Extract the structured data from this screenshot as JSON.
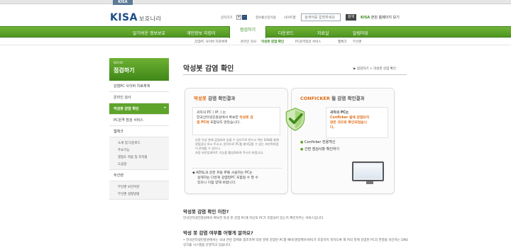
{
  "header": {
    "top_tab": "KISA",
    "logo": "KISA",
    "logo_sub": "보호나라",
    "util_font_label": "글자크기",
    "util_font_plus": "+",
    "util_font_minus": "-",
    "util_links": [
      "정보통신망이용",
      "사이트맵"
    ],
    "search_placeholder": "검색어를 입력하세요",
    "search_button": "검색",
    "kisa_link_prefix": "KISA",
    "kisa_link_text": "본원 홈페이지 보기"
  },
  "gnb": [
    {
      "label": "알기쉬운 정보보호"
    },
    {
      "label": "개인정보 지킴이"
    },
    {
      "label": "점검하기"
    },
    {
      "label": "다운로드"
    },
    {
      "label": "자료실"
    },
    {
      "label": "알림마당"
    }
  ],
  "subnav": [
    "감염PC 사이버 치료체계",
    "온라인 검사",
    "악성봇 감염 확인",
    "PC원격점검 서비스",
    "웹체크",
    "무선랜"
  ],
  "lnb": {
    "head_en": "BOHO",
    "head_ko": "점검하기",
    "items": [
      "감염PC 사이버 치료체계",
      "온라인 검사",
      "악성봇 감염 확인",
      "PC원격 점검 서비스",
      "웹체크"
    ],
    "webcheck_sub": [
      "소개 및 다운로드",
      "주요기능",
      "결점도 적용 및 조치법",
      "도움말"
    ],
    "wireless": "무선랜",
    "wireless_sub": [
      "무선랜 보안이란",
      "무선랜 설정방법"
    ]
  },
  "content": {
    "title": "악성봇 감염 확인",
    "breadcrumb": [
      "▶ 점검하기",
      ">",
      "악성봇 감염 확인"
    ],
    "box1": {
      "title_hl": "악성봇",
      "title_rest": " 감염 확인결과",
      "line1": "귀하의 PC ( IP:                         ) 는",
      "line2a": "한국인터넷진흥원에서 확보한 ",
      "line2b": "악성봇 감",
      "line3a": "염 PC에",
      "line3b": " 포함되지 않았습니다.",
      "small": [
        "다른 악성 봇에 감염되어 있을 수 있으므로 반드시 백신 S/W를 통해 정밀검사 하시 주시고, 원격으로 PC를 제어당할 수 있는 보안취약점이 존재할 수 있으니",
        "자동 보안업데이트 기능을 활성화하여 주시기 바랍니다."
      ],
      "note": [
        "ADSL과 같은 유동 IP를 사용하는 PC는",
        "실제하는 다른게 감염된PC 포함될 수 할 수",
        "있으니 이점 양해 바랍니다."
      ]
    },
    "box2": {
      "title_hl": "CONFICKER",
      "title_rest": " 웜 감염 확인결과",
      "line1": "귀하의 PC는",
      "line2": "Conficker 웜에 감염되지",
      "line3": "않은 것으로 확인되었습니",
      "line4": "다.",
      "link1": "Conficker 전용백신",
      "link2": "간편 점검사항 확인하기"
    },
    "sec1_h": "악성봇 감염 확인 이란?",
    "sec1_p": "한국인터넷진흥원에서 확보한 악성 봇 감염 PC에 자신의 PC가 포함되어 있는지 확인하주는 서비스입니다.",
    "sec2_h": "악성 봇 감염 여부를 어떻게 알까요?",
    "sec2_p": "• 한국인터넷진흥원에서는 국내 관련 업체와 협조하여 악성 봇에 감염된 PC를 예비(명령제어서버)가 조종하지 못하도록 해 커의 봇에 감염된 PC의 연결을 차단하는 DNS 싱크홀 시스템을 운영하고 있습니다."
  }
}
